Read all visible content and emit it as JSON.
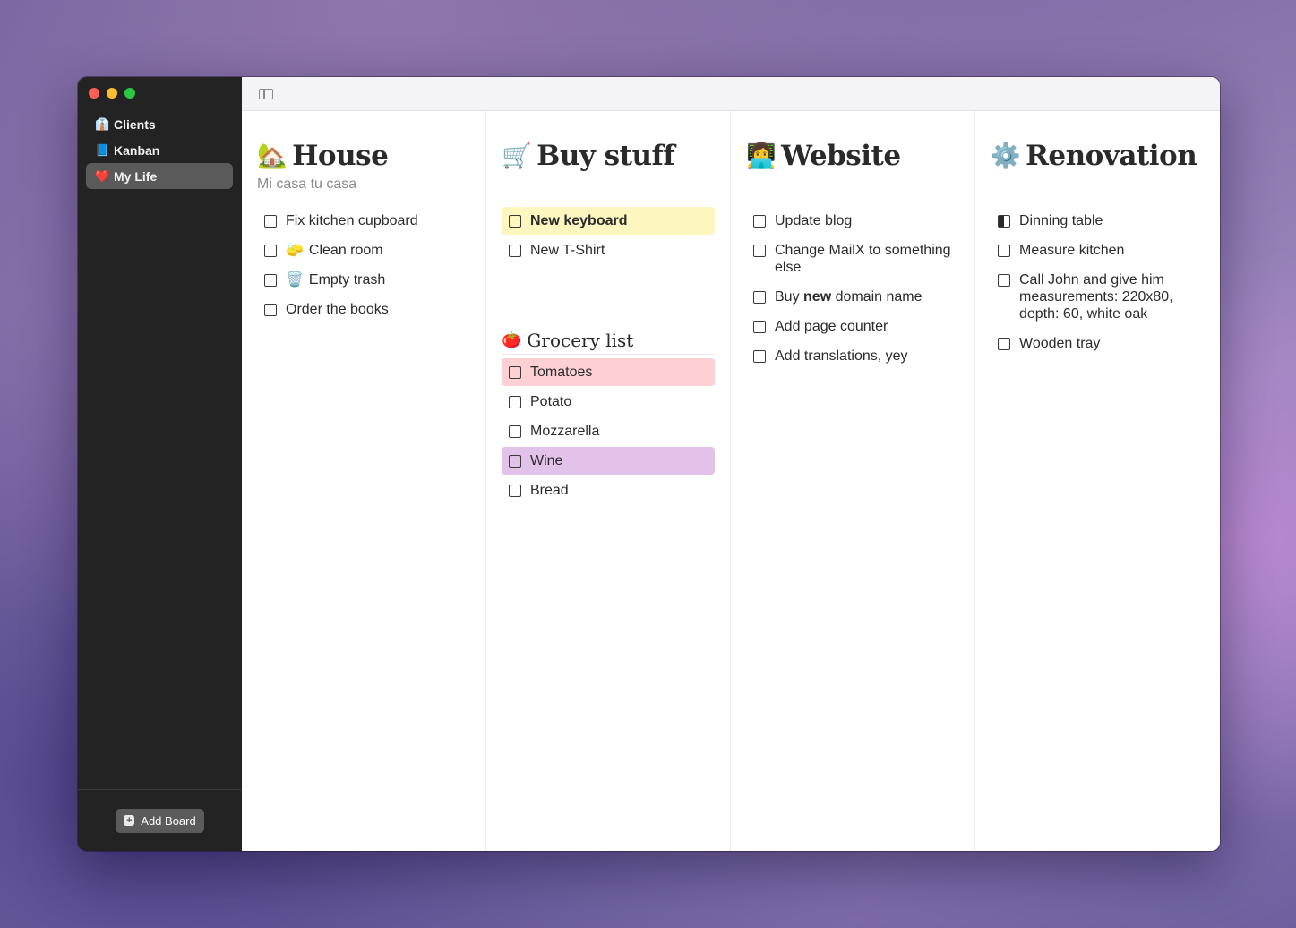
{
  "sidebar": {
    "boards": [
      {
        "emoji": "👔",
        "label": "Clients"
      },
      {
        "emoji": "📘",
        "label": "Kanban"
      },
      {
        "emoji": "❤️",
        "label": "My Life"
      }
    ],
    "add_board_label": "Add Board"
  },
  "columns": [
    {
      "emoji": "🏡",
      "title": "House",
      "subtitle": "Mi casa tu casa",
      "tasks": [
        {
          "label": "Fix kitchen cupboard"
        },
        {
          "emoji": "🧽",
          "label": "Clean room"
        },
        {
          "emoji": "🗑️",
          "label": "Empty trash"
        },
        {
          "label": "Order the books"
        }
      ]
    },
    {
      "emoji": "🛒",
      "title": "Buy stuff",
      "tasks": [
        {
          "label": "New keyboard",
          "highlight": "#fdf7bf",
          "bold": true
        },
        {
          "label": "New T-Shirt"
        }
      ],
      "section": {
        "emoji": "🍅",
        "title": "Grocery list",
        "tasks": [
          {
            "label": "Tomatoes",
            "highlight": "#fdd0d3"
          },
          {
            "label": "Potato"
          },
          {
            "label": "Mozzarella"
          },
          {
            "label": "Wine",
            "highlight": "#e3c2ea"
          },
          {
            "label": "Bread"
          }
        ]
      }
    },
    {
      "emoji": "👩‍💻",
      "title": "Website",
      "tasks": [
        {
          "label": "Update blog"
        },
        {
          "label": "Change MailX to something else"
        },
        {
          "label_parts": [
            "Buy ",
            "new",
            " domain name"
          ]
        },
        {
          "label": "Add page counter"
        },
        {
          "label": "Add translations, yey"
        }
      ]
    },
    {
      "emoji": "⚙️",
      "title": "Renovation",
      "tasks": [
        {
          "label": "Dinning table",
          "state": "partial"
        },
        {
          "label": "Measure kitchen"
        },
        {
          "label": "Call John and give him measurements: 220x80, depth: 60, white oak"
        },
        {
          "label": "Wooden tray"
        }
      ]
    }
  ]
}
